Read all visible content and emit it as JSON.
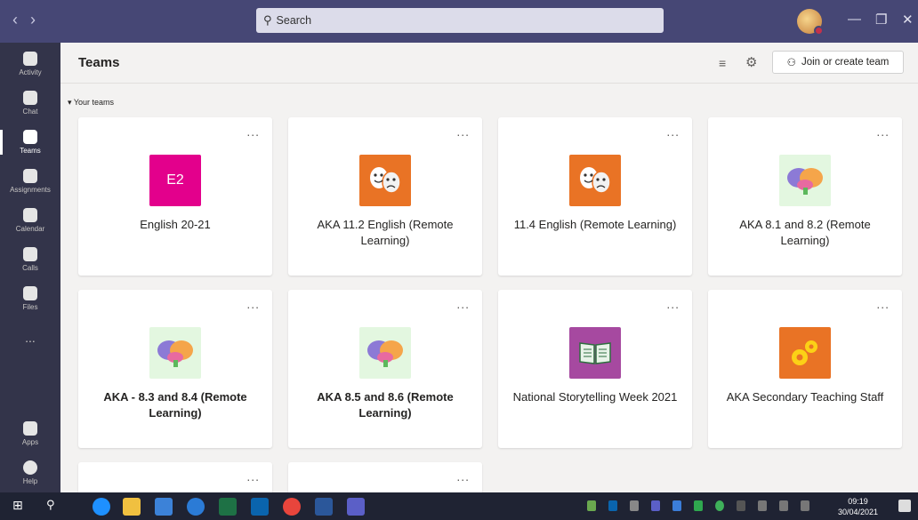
{
  "titlebar": {
    "back": "‹",
    "forward": "›",
    "search_placeholder": "Search",
    "minimize": "—",
    "maximize": "❐",
    "close": "✕"
  },
  "rail": [
    {
      "label": "Activity"
    },
    {
      "label": "Chat"
    },
    {
      "label": "Teams",
      "active": true
    },
    {
      "label": "Assignments"
    },
    {
      "label": "Calendar"
    },
    {
      "label": "Calls"
    },
    {
      "label": "Files"
    },
    {
      "label": "..."
    },
    {
      "label": "Apps"
    },
    {
      "label": "Help"
    }
  ],
  "header": {
    "title": "Teams",
    "join_label": "Join or create team"
  },
  "section_label": "Your teams",
  "teams": [
    {
      "name": "English 20-21",
      "logo": "E2",
      "color": "#e3008c",
      "bold": false
    },
    {
      "name": "AKA 11.2 English (Remote Learning)",
      "logo": "theatre-masks",
      "color": "#e97325",
      "bold": false
    },
    {
      "name": "11.4 English (Remote Learning)",
      "logo": "theatre-masks",
      "color": "#e97325",
      "bold": false
    },
    {
      "name": "AKA 8.1 and 8.2 (Remote Learning)",
      "logo": "brain",
      "color": "#e3f7e0",
      "bold": false
    },
    {
      "name": "AKA - 8.3 and 8.4 (Remote Learning)",
      "logo": "brain",
      "color": "#e3f7e0",
      "bold": true
    },
    {
      "name": "AKA 8.5 and 8.6 (Remote Learning)",
      "logo": "brain",
      "color": "#e3f7e0",
      "bold": true
    },
    {
      "name": "National Storytelling Week 2021",
      "logo": "book",
      "color": "#a649a0",
      "bold": false
    },
    {
      "name": "AKA Secondary Teaching Staff",
      "logo": "gears",
      "color": "#e97325",
      "bold": false
    },
    {
      "name": "",
      "logo": "",
      "color": "#ffffff",
      "bold": false
    },
    {
      "name": "",
      "logo": "",
      "color": "#ffffff",
      "bold": false
    }
  ],
  "more_label": "...",
  "clock": {
    "time": "09:19",
    "date": "30/04/2021"
  }
}
